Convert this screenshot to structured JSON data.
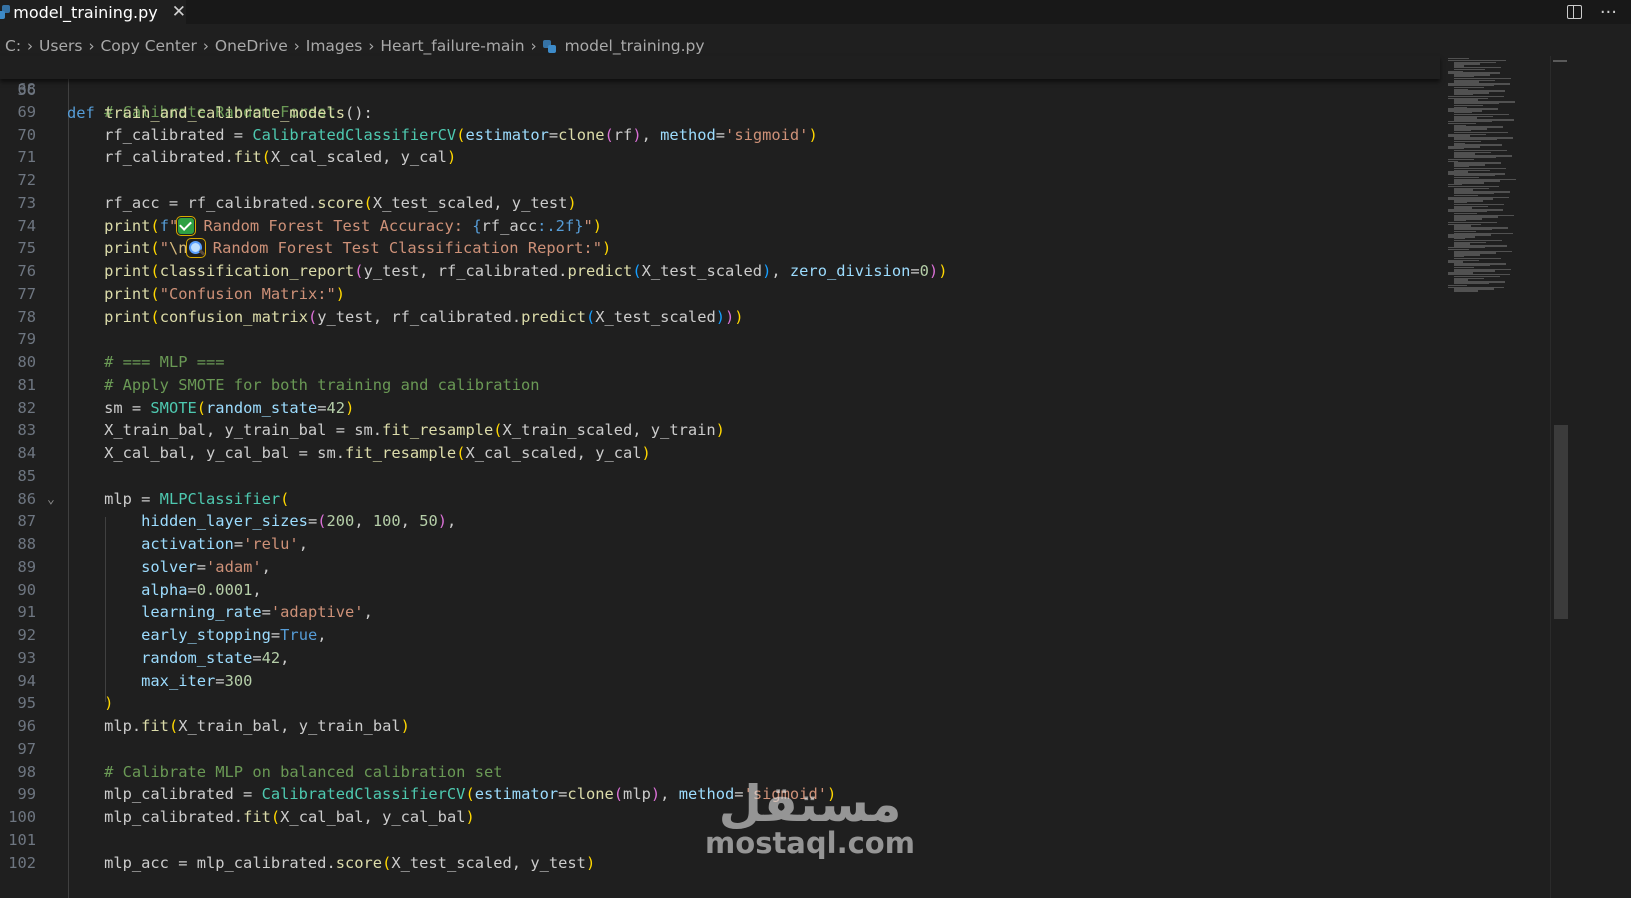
{
  "tab": {
    "filename": "model_training.py",
    "close": "✕"
  },
  "tab_actions": {
    "more": "···"
  },
  "breadcrumb": {
    "drive": "C:",
    "parts": [
      "Users",
      "Copy Center",
      "OneDrive",
      "Images",
      "Heart_failure-main"
    ],
    "file": "model_training.py"
  },
  "sticky": {
    "ln": "36",
    "def": "def",
    "name": "train_and_calibrate_models",
    "rest": "():"
  },
  "lines": [
    {
      "ln": "68",
      "t": []
    },
    {
      "ln": "69",
      "t": [
        [
          "",
          "    "
        ],
        [
          "cm",
          "# Calibrate Random Forest"
        ]
      ]
    },
    {
      "ln": "70",
      "t": [
        [
          "",
          "    rf_calibrated = "
        ],
        [
          "cls",
          "CalibratedClassifierCV"
        ],
        [
          "b1",
          "("
        ],
        [
          "var",
          "estimator"
        ],
        [
          "",
          "="
        ],
        [
          "fn",
          "clone"
        ],
        [
          "b2",
          "("
        ],
        [
          "",
          "rf"
        ],
        [
          "b2",
          ")"
        ],
        [
          "",
          ", "
        ],
        [
          "var",
          "method"
        ],
        [
          "",
          "="
        ],
        [
          "str",
          "'sigmoid'"
        ],
        [
          "b1",
          ")"
        ]
      ]
    },
    {
      "ln": "71",
      "t": [
        [
          "",
          "    rf_calibrated."
        ],
        [
          "fn",
          "fit"
        ],
        [
          "b1",
          "("
        ],
        [
          "",
          "X_cal_scaled, y_cal"
        ],
        [
          "b1",
          ")"
        ]
      ]
    },
    {
      "ln": "72",
      "t": []
    },
    {
      "ln": "73",
      "t": [
        [
          "",
          "    rf_acc = rf_calibrated."
        ],
        [
          "fn",
          "score"
        ],
        [
          "b1",
          "("
        ],
        [
          "",
          "X_test_scaled, y_test"
        ],
        [
          "b1",
          ")"
        ]
      ]
    },
    {
      "ln": "74",
      "t": [
        [
          "",
          "    "
        ],
        [
          "fn",
          "print"
        ],
        [
          "b1",
          "("
        ],
        [
          "kw",
          "f"
        ],
        [
          "str",
          "\""
        ],
        [
          "emoji",
          "check"
        ],
        [
          "str",
          " Random Forest Test Accuracy: "
        ],
        [
          "kw",
          "{"
        ],
        [
          "",
          "rf_acc"
        ],
        [
          "kw",
          ":.2f}"
        ],
        [
          "str",
          "\""
        ],
        [
          "b1",
          ")"
        ]
      ]
    },
    {
      "ln": "75",
      "t": [
        [
          "",
          "    "
        ],
        [
          "fn",
          "print"
        ],
        [
          "b1",
          "("
        ],
        [
          "str",
          "\""
        ],
        [
          "esc",
          "\\n"
        ],
        [
          "emoji",
          "mag"
        ],
        [
          "str",
          " Random Forest Test Classification Report:\""
        ],
        [
          "b1",
          ")"
        ]
      ]
    },
    {
      "ln": "76",
      "t": [
        [
          "",
          "    "
        ],
        [
          "fn",
          "print"
        ],
        [
          "b1",
          "("
        ],
        [
          "fn",
          "classification_report"
        ],
        [
          "b2",
          "("
        ],
        [
          "",
          "y_test, rf_calibrated."
        ],
        [
          "fn",
          "predict"
        ],
        [
          "b3",
          "("
        ],
        [
          "",
          "X_test_scaled"
        ],
        [
          "b3",
          ")"
        ],
        [
          "",
          ", "
        ],
        [
          "var",
          "zero_division"
        ],
        [
          "",
          "="
        ],
        [
          "num",
          "0"
        ],
        [
          "b2",
          ")"
        ],
        [
          "b1",
          ")"
        ]
      ]
    },
    {
      "ln": "77",
      "t": [
        [
          "",
          "    "
        ],
        [
          "fn",
          "print"
        ],
        [
          "b1",
          "("
        ],
        [
          "str",
          "\"Confusion Matrix:\""
        ],
        [
          "b1",
          ")"
        ]
      ]
    },
    {
      "ln": "78",
      "t": [
        [
          "",
          "    "
        ],
        [
          "fn",
          "print"
        ],
        [
          "b1",
          "("
        ],
        [
          "fn",
          "confusion_matrix"
        ],
        [
          "b2",
          "("
        ],
        [
          "",
          "y_test, rf_calibrated."
        ],
        [
          "fn",
          "predict"
        ],
        [
          "b3",
          "("
        ],
        [
          "",
          "X_test_scaled"
        ],
        [
          "b3",
          ")"
        ],
        [
          "b2",
          ")"
        ],
        [
          "b1",
          ")"
        ]
      ]
    },
    {
      "ln": "79",
      "t": []
    },
    {
      "ln": "80",
      "t": [
        [
          "",
          "    "
        ],
        [
          "cm",
          "# === MLP ==="
        ]
      ]
    },
    {
      "ln": "81",
      "t": [
        [
          "",
          "    "
        ],
        [
          "cm",
          "# Apply SMOTE for both training and calibration"
        ]
      ]
    },
    {
      "ln": "82",
      "t": [
        [
          "",
          "    sm = "
        ],
        [
          "cls",
          "SMOTE"
        ],
        [
          "b1",
          "("
        ],
        [
          "var",
          "random_state"
        ],
        [
          "",
          "="
        ],
        [
          "num",
          "42"
        ],
        [
          "b1",
          ")"
        ]
      ]
    },
    {
      "ln": "83",
      "t": [
        [
          "",
          "    X_train_bal, y_train_bal = sm."
        ],
        [
          "fn",
          "fit_resample"
        ],
        [
          "b1",
          "("
        ],
        [
          "",
          "X_train_scaled, y_train"
        ],
        [
          "b1",
          ")"
        ]
      ]
    },
    {
      "ln": "84",
      "t": [
        [
          "",
          "    X_cal_bal, y_cal_bal = sm."
        ],
        [
          "fn",
          "fit_resample"
        ],
        [
          "b1",
          "("
        ],
        [
          "",
          "X_cal_scaled, y_cal"
        ],
        [
          "b1",
          ")"
        ]
      ]
    },
    {
      "ln": "85",
      "t": []
    },
    {
      "ln": "86",
      "fold": true,
      "t": [
        [
          "",
          "    mlp = "
        ],
        [
          "cls",
          "MLPClassifier"
        ],
        [
          "b1",
          "("
        ]
      ]
    },
    {
      "ln": "87",
      "t": [
        [
          "",
          "        "
        ],
        [
          "var",
          "hidden_layer_sizes"
        ],
        [
          "",
          "="
        ],
        [
          "b2",
          "("
        ],
        [
          "num",
          "200"
        ],
        [
          "",
          ", "
        ],
        [
          "num",
          "100"
        ],
        [
          "",
          ", "
        ],
        [
          "num",
          "50"
        ],
        [
          "b2",
          ")"
        ],
        [
          "",
          ","
        ]
      ]
    },
    {
      "ln": "88",
      "t": [
        [
          "",
          "        "
        ],
        [
          "var",
          "activation"
        ],
        [
          "",
          "="
        ],
        [
          "str",
          "'relu'"
        ],
        [
          "",
          ","
        ]
      ]
    },
    {
      "ln": "89",
      "t": [
        [
          "",
          "        "
        ],
        [
          "var",
          "solver"
        ],
        [
          "",
          "="
        ],
        [
          "str",
          "'adam'"
        ],
        [
          "",
          ","
        ]
      ]
    },
    {
      "ln": "90",
      "t": [
        [
          "",
          "        "
        ],
        [
          "var",
          "alpha"
        ],
        [
          "",
          "="
        ],
        [
          "num",
          "0.0001"
        ],
        [
          "",
          ","
        ]
      ]
    },
    {
      "ln": "91",
      "t": [
        [
          "",
          "        "
        ],
        [
          "var",
          "learning_rate"
        ],
        [
          "",
          "="
        ],
        [
          "str",
          "'adaptive'"
        ],
        [
          "",
          ","
        ]
      ]
    },
    {
      "ln": "92",
      "t": [
        [
          "",
          "        "
        ],
        [
          "var",
          "early_stopping"
        ],
        [
          "",
          "="
        ],
        [
          "kw",
          "True"
        ],
        [
          "",
          ","
        ]
      ]
    },
    {
      "ln": "93",
      "t": [
        [
          "",
          "        "
        ],
        [
          "var",
          "random_state"
        ],
        [
          "",
          "="
        ],
        [
          "num",
          "42"
        ],
        [
          "",
          ","
        ]
      ]
    },
    {
      "ln": "94",
      "t": [
        [
          "",
          "        "
        ],
        [
          "var",
          "max_iter"
        ],
        [
          "",
          "="
        ],
        [
          "num",
          "300"
        ]
      ]
    },
    {
      "ln": "95",
      "t": [
        [
          "",
          "    "
        ],
        [
          "b1",
          ")"
        ]
      ]
    },
    {
      "ln": "96",
      "t": [
        [
          "",
          "    mlp."
        ],
        [
          "fn",
          "fit"
        ],
        [
          "b1",
          "("
        ],
        [
          "",
          "X_train_bal, y_train_bal"
        ],
        [
          "b1",
          ")"
        ]
      ]
    },
    {
      "ln": "97",
      "t": []
    },
    {
      "ln": "98",
      "t": [
        [
          "",
          "    "
        ],
        [
          "cm",
          "# Calibrate MLP on balanced calibration set"
        ]
      ]
    },
    {
      "ln": "99",
      "t": [
        [
          "",
          "    mlp_calibrated = "
        ],
        [
          "cls",
          "CalibratedClassifierCV"
        ],
        [
          "b1",
          "("
        ],
        [
          "var",
          "estimator"
        ],
        [
          "",
          "="
        ],
        [
          "fn",
          "clone"
        ],
        [
          "b2",
          "("
        ],
        [
          "",
          "mlp"
        ],
        [
          "b2",
          ")"
        ],
        [
          "",
          ", "
        ],
        [
          "var",
          "method"
        ],
        [
          "",
          "="
        ],
        [
          "str",
          "'sigmoid'"
        ],
        [
          "b1",
          ")"
        ]
      ]
    },
    {
      "ln": "100",
      "t": [
        [
          "",
          "    mlp_calibrated."
        ],
        [
          "fn",
          "fit"
        ],
        [
          "b1",
          "("
        ],
        [
          "",
          "X_cal_bal, y_cal_bal"
        ],
        [
          "b1",
          ")"
        ]
      ]
    },
    {
      "ln": "101",
      "t": []
    },
    {
      "ln": "102",
      "t": [
        [
          "",
          "    mlp_acc = mlp_calibrated."
        ],
        [
          "fn",
          "score"
        ],
        [
          "b1",
          "("
        ],
        [
          "",
          "X_test_scaled, y_test"
        ],
        [
          "b1",
          ")"
        ]
      ]
    }
  ],
  "watermark": {
    "arabic": "مستقل",
    "latin": "mostaql.com"
  }
}
